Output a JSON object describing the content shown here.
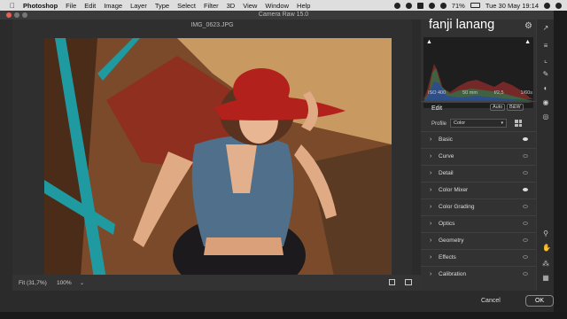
{
  "menubar": {
    "app": "Photoshop",
    "items": [
      "File",
      "Edit",
      "Image",
      "Layer",
      "Type",
      "Select",
      "Filter",
      "3D",
      "View",
      "Window",
      "Help"
    ],
    "battery": "71%",
    "datetime": "Tue 30 May  19:14"
  },
  "window": {
    "title": "Camera Raw 15.0"
  },
  "image": {
    "filename": "IMG_0623.JPG"
  },
  "overlay_text": "fanji lanang",
  "histogram_meta": {
    "iso": "ISO 400",
    "focal": "50 mm",
    "aperture": "f/2,5",
    "shutter": "1/60s"
  },
  "edit": {
    "title": "Edit",
    "auto_label": "Auto",
    "bw_label": "B&W",
    "profile_label": "Profile",
    "profile_value": "Color"
  },
  "panels": [
    {
      "label": "Basic",
      "visible": true
    },
    {
      "label": "Curve",
      "visible": false
    },
    {
      "label": "Detail",
      "visible": false
    },
    {
      "label": "Color Mixer",
      "visible": true
    },
    {
      "label": "Color Grading",
      "visible": false
    },
    {
      "label": "Optics",
      "visible": false
    },
    {
      "label": "Geometry",
      "visible": false
    },
    {
      "label": "Effects",
      "visible": false
    },
    {
      "label": "Calibration",
      "visible": false
    }
  ],
  "bottom": {
    "fit": "Fit (31,7%)",
    "zoom": "100%"
  },
  "footer": {
    "cancel": "Cancel",
    "ok": "OK"
  },
  "colors": {
    "accent_red_hat": "#b3211d",
    "denim": "#4f6f8a",
    "teal_rail": "#1f9aa0"
  }
}
